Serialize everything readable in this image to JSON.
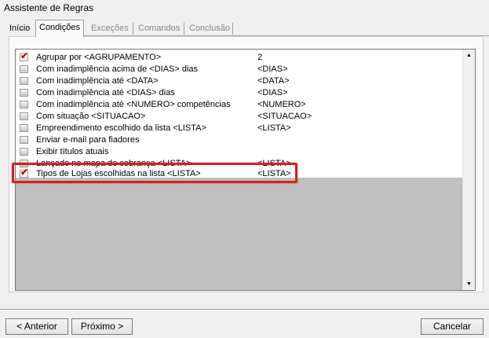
{
  "window": {
    "title": "Assistente de Regras"
  },
  "tabs": [
    {
      "label": "Início",
      "state": "normal"
    },
    {
      "label": "Condições",
      "state": "active"
    },
    {
      "label": "Exceções",
      "state": "disabled"
    },
    {
      "label": "Comandos",
      "state": "disabled"
    },
    {
      "label": "Conclusão",
      "state": "disabled"
    }
  ],
  "conditions": [
    {
      "label": "Agrupar por <AGRUPAMENTO>",
      "value": "2",
      "checked": true
    },
    {
      "label": "Com inadimplência acima de <DIAS> dias",
      "value": "<DIAS>",
      "checked": false
    },
    {
      "label": "Com inadimplência até <DATA>",
      "value": "<DATA>",
      "checked": false
    },
    {
      "label": "Com inadimplência até <DIAS>  dias",
      "value": "<DIAS>",
      "checked": false
    },
    {
      "label": "Com inadimplência até <NUMERO> competências",
      "value": "<NUMERO>",
      "checked": false
    },
    {
      "label": "Com situação <SITUACAO>",
      "value": "<SITUACAO>",
      "checked": false
    },
    {
      "label": "Empreendimento escolhido da lista <LISTA>",
      "value": "<LISTA>",
      "checked": false
    },
    {
      "label": "Enviar e-mail para fiadores",
      "value": "",
      "checked": false
    },
    {
      "label": "Exibir títulos atuais",
      "value": "",
      "checked": false
    },
    {
      "label": "Lançado no mapa de cobrança <LISTA>",
      "value": "<LISTA>",
      "checked": false
    },
    {
      "label": "Tipos de Lojas escolhidas na lista <LISTA>",
      "value": "<LISTA>",
      "checked": true
    }
  ],
  "buttons": {
    "prev": "< Anterior",
    "next": "Próximo >",
    "cancel": "Cancelar"
  },
  "colors": {
    "highlight": "#d42020",
    "check": "#cc0000"
  }
}
